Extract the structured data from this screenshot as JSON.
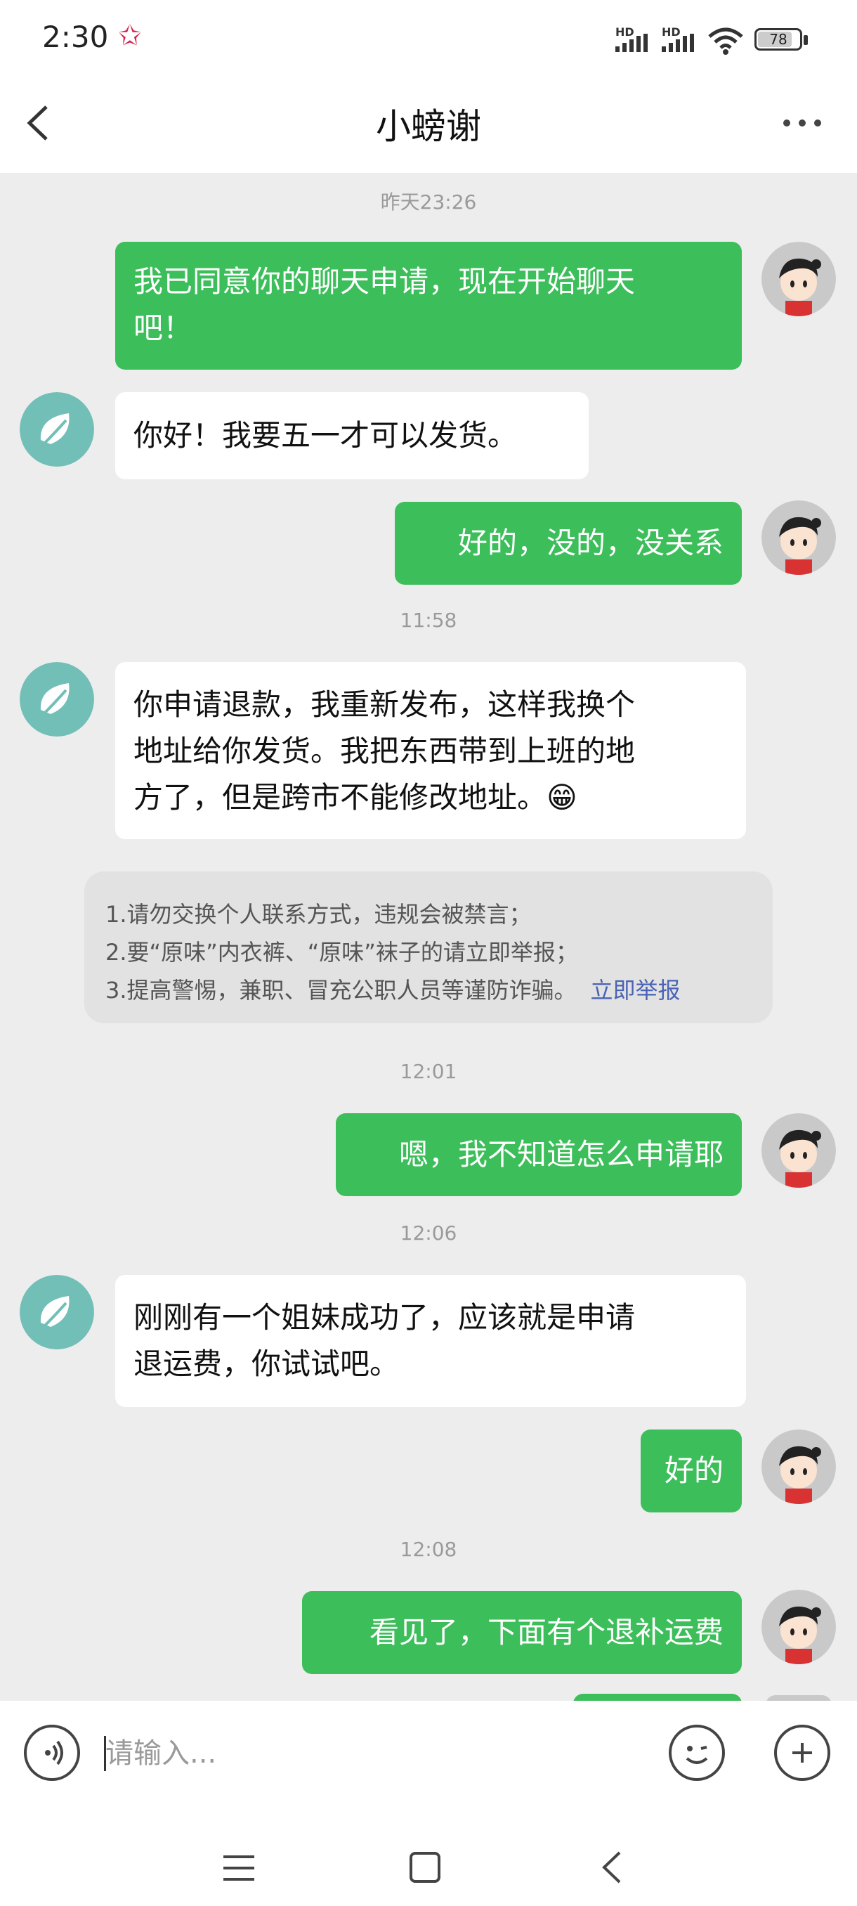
{
  "status_bar": {
    "time": "2:30",
    "signal_labels": [
      "HD",
      "HD"
    ],
    "battery": "78"
  },
  "header": {
    "title": "小螃谢"
  },
  "messages": [
    {
      "type": "timestamp",
      "text": "昨天23:26"
    },
    {
      "type": "sent",
      "lines": [
        "我已同意你的聊天申请，现在开始聊天",
        "吧！"
      ]
    },
    {
      "type": "received",
      "lines": [
        "你好！我要五一才可以发货。"
      ]
    },
    {
      "type": "sent",
      "lines": [
        "好的，没的，没关系"
      ]
    },
    {
      "type": "timestamp",
      "text": "11:58"
    },
    {
      "type": "received",
      "lines": [
        "你申请退款，我重新发布，这样我换个",
        "地址给你发货。我把东西带到上班的地",
        "方了，但是跨市不能修改地址。"
      ],
      "emoji": "😁"
    },
    {
      "type": "notice",
      "lines": [
        "1.请勿交换个人联系方式，违规会被禁言；",
        "2.要“原味”内衣裤、“原味”袜子的请立即举报；",
        "3.提高警惕，兼职、冒充公职人员等谨防诈骗。"
      ],
      "link": "立即举报"
    },
    {
      "type": "timestamp",
      "text": "12:01"
    },
    {
      "type": "sent",
      "lines": [
        "嗯，我不知道怎么申请耶"
      ]
    },
    {
      "type": "timestamp",
      "text": "12:06"
    },
    {
      "type": "received",
      "lines": [
        "刚刚有一个姐妹成功了，应该就是申请",
        "退运费，你试试吧。"
      ]
    },
    {
      "type": "sent",
      "lines": [
        "好的"
      ]
    },
    {
      "type": "timestamp",
      "text": "12:08"
    },
    {
      "type": "sent",
      "lines": [
        "看见了，下面有个退补运费"
      ]
    }
  ],
  "input": {
    "placeholder": "请输入..."
  },
  "icons": {
    "back": "back-chevron-icon",
    "more": "more-dots-icon",
    "voice": "voice-icon",
    "emoji": "emoji-icon",
    "plus": "plus-icon"
  },
  "colors": {
    "sent_bubble": "#3cbe5a",
    "received_bubble": "#ffffff",
    "background": "#ededed",
    "link": "#4a63b5"
  }
}
